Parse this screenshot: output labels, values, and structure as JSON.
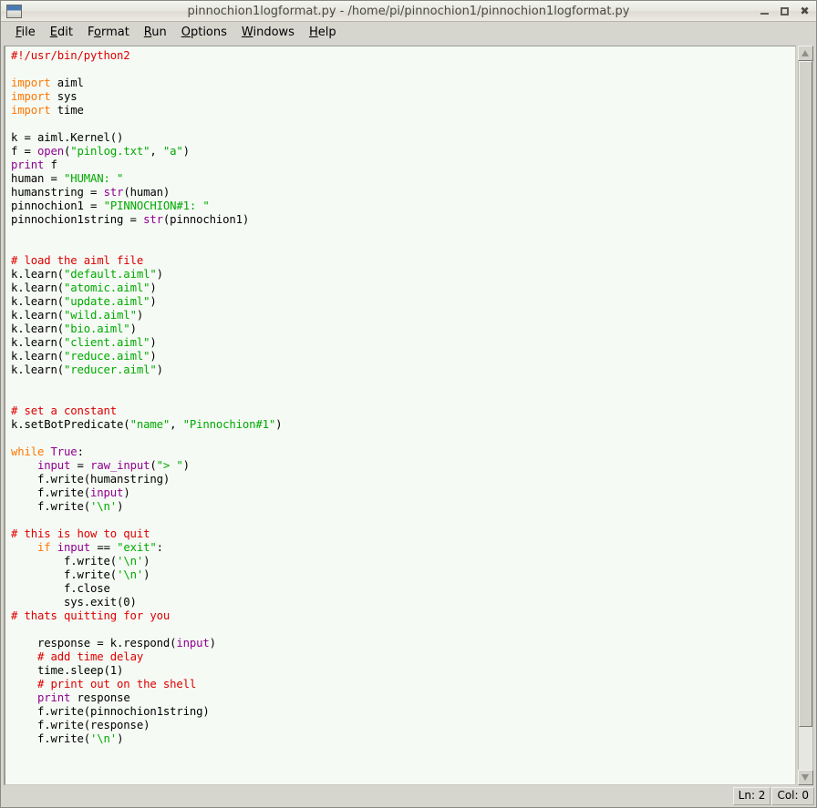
{
  "window": {
    "title": "pinnochion1logformat.py - /home/pi/pinnochion1/pinnochion1logformat.py",
    "icon": "window-icon",
    "minimize_label": "_",
    "maximize_label": "□",
    "close_label": "✖"
  },
  "menubar": {
    "items": [
      {
        "label": "File",
        "mnemonic_index": 0
      },
      {
        "label": "Edit",
        "mnemonic_index": 0
      },
      {
        "label": "Format",
        "mnemonic_index": 1
      },
      {
        "label": "Run",
        "mnemonic_index": 0
      },
      {
        "label": "Options",
        "mnemonic_index": 0
      },
      {
        "label": "Windows",
        "mnemonic_index": 0
      },
      {
        "label": "Help",
        "mnemonic_index": 0
      }
    ]
  },
  "statusbar": {
    "line_label": "Ln: 2",
    "column_label": "Col: 0"
  },
  "colors": {
    "comment": "#dd0000",
    "keyword": "#ff7700",
    "string": "#00aa00",
    "builtin": "#900090",
    "plain": "#000000",
    "editor_background": "#f6faf5",
    "chrome": "#d6d6ce"
  },
  "editor": {
    "filename": "pinnochion1logformat.py",
    "language": "python",
    "lines": [
      [
        {
          "t": "#!/usr/bin/python2",
          "c": "comment"
        }
      ],
      [],
      [
        {
          "t": "import",
          "c": "keyword"
        },
        {
          "t": " aiml",
          "c": "plain"
        }
      ],
      [
        {
          "t": "import",
          "c": "keyword"
        },
        {
          "t": " sys",
          "c": "plain"
        }
      ],
      [
        {
          "t": "import",
          "c": "keyword"
        },
        {
          "t": " time",
          "c": "plain"
        }
      ],
      [],
      [
        {
          "t": "k = aiml.Kernel()",
          "c": "plain"
        }
      ],
      [
        {
          "t": "f = ",
          "c": "plain"
        },
        {
          "t": "open",
          "c": "builtin"
        },
        {
          "t": "(",
          "c": "plain"
        },
        {
          "t": "\"pinlog.txt\"",
          "c": "string"
        },
        {
          "t": ", ",
          "c": "plain"
        },
        {
          "t": "\"a\"",
          "c": "string"
        },
        {
          "t": ")",
          "c": "plain"
        }
      ],
      [
        {
          "t": "print",
          "c": "builtin"
        },
        {
          "t": " f",
          "c": "plain"
        }
      ],
      [
        {
          "t": "human = ",
          "c": "plain"
        },
        {
          "t": "\"HUMAN: \"",
          "c": "string"
        }
      ],
      [
        {
          "t": "humanstring = ",
          "c": "plain"
        },
        {
          "t": "str",
          "c": "builtin"
        },
        {
          "t": "(human)",
          "c": "plain"
        }
      ],
      [
        {
          "t": "pinnochion1 = ",
          "c": "plain"
        },
        {
          "t": "\"PINNOCHION#1: \"",
          "c": "string"
        }
      ],
      [
        {
          "t": "pinnochion1string = ",
          "c": "plain"
        },
        {
          "t": "str",
          "c": "builtin"
        },
        {
          "t": "(pinnochion1)",
          "c": "plain"
        }
      ],
      [],
      [],
      [
        {
          "t": "# load the aiml file",
          "c": "comment"
        }
      ],
      [
        {
          "t": "k.learn(",
          "c": "plain"
        },
        {
          "t": "\"default.aiml\"",
          "c": "string"
        },
        {
          "t": ")",
          "c": "plain"
        }
      ],
      [
        {
          "t": "k.learn(",
          "c": "plain"
        },
        {
          "t": "\"atomic.aiml\"",
          "c": "string"
        },
        {
          "t": ")",
          "c": "plain"
        }
      ],
      [
        {
          "t": "k.learn(",
          "c": "plain"
        },
        {
          "t": "\"update.aiml\"",
          "c": "string"
        },
        {
          "t": ")",
          "c": "plain"
        }
      ],
      [
        {
          "t": "k.learn(",
          "c": "plain"
        },
        {
          "t": "\"wild.aiml\"",
          "c": "string"
        },
        {
          "t": ")",
          "c": "plain"
        }
      ],
      [
        {
          "t": "k.learn(",
          "c": "plain"
        },
        {
          "t": "\"bio.aiml\"",
          "c": "string"
        },
        {
          "t": ")",
          "c": "plain"
        }
      ],
      [
        {
          "t": "k.learn(",
          "c": "plain"
        },
        {
          "t": "\"client.aiml\"",
          "c": "string"
        },
        {
          "t": ")",
          "c": "plain"
        }
      ],
      [
        {
          "t": "k.learn(",
          "c": "plain"
        },
        {
          "t": "\"reduce.aiml\"",
          "c": "string"
        },
        {
          "t": ")",
          "c": "plain"
        }
      ],
      [
        {
          "t": "k.learn(",
          "c": "plain"
        },
        {
          "t": "\"reducer.aiml\"",
          "c": "string"
        },
        {
          "t": ")",
          "c": "plain"
        }
      ],
      [],
      [],
      [
        {
          "t": "# set a constant",
          "c": "comment"
        }
      ],
      [
        {
          "t": "k.setBotPredicate(",
          "c": "plain"
        },
        {
          "t": "\"name\"",
          "c": "string"
        },
        {
          "t": ", ",
          "c": "plain"
        },
        {
          "t": "\"Pinnochion#1\"",
          "c": "string"
        },
        {
          "t": ")",
          "c": "plain"
        }
      ],
      [],
      [
        {
          "t": "while",
          "c": "keyword"
        },
        {
          "t": " ",
          "c": "plain"
        },
        {
          "t": "True",
          "c": "builtin"
        },
        {
          "t": ":",
          "c": "plain"
        }
      ],
      [
        {
          "t": "    ",
          "c": "plain"
        },
        {
          "t": "input",
          "c": "builtin"
        },
        {
          "t": " = ",
          "c": "plain"
        },
        {
          "t": "raw_input",
          "c": "builtin"
        },
        {
          "t": "(",
          "c": "plain"
        },
        {
          "t": "\"> \"",
          "c": "string"
        },
        {
          "t": ")",
          "c": "plain"
        }
      ],
      [
        {
          "t": "    f.write(humanstring)",
          "c": "plain"
        }
      ],
      [
        {
          "t": "    f.write(",
          "c": "plain"
        },
        {
          "t": "input",
          "c": "builtin"
        },
        {
          "t": ")",
          "c": "plain"
        }
      ],
      [
        {
          "t": "    f.write(",
          "c": "plain"
        },
        {
          "t": "'\\n'",
          "c": "string"
        },
        {
          "t": ")",
          "c": "plain"
        }
      ],
      [],
      [
        {
          "t": "# this is how to quit",
          "c": "comment"
        }
      ],
      [
        {
          "t": "    ",
          "c": "plain"
        },
        {
          "t": "if",
          "c": "keyword"
        },
        {
          "t": " ",
          "c": "plain"
        },
        {
          "t": "input",
          "c": "builtin"
        },
        {
          "t": " == ",
          "c": "plain"
        },
        {
          "t": "\"exit\"",
          "c": "string"
        },
        {
          "t": ":",
          "c": "plain"
        }
      ],
      [
        {
          "t": "        f.write(",
          "c": "plain"
        },
        {
          "t": "'\\n'",
          "c": "string"
        },
        {
          "t": ")",
          "c": "plain"
        }
      ],
      [
        {
          "t": "        f.write(",
          "c": "plain"
        },
        {
          "t": "'\\n'",
          "c": "string"
        },
        {
          "t": ")",
          "c": "plain"
        }
      ],
      [
        {
          "t": "        f.close",
          "c": "plain"
        }
      ],
      [
        {
          "t": "        sys.exit(0)",
          "c": "plain"
        }
      ],
      [
        {
          "t": "# thats quitting for you",
          "c": "comment"
        }
      ],
      [],
      [
        {
          "t": "    response = k.respond(",
          "c": "plain"
        },
        {
          "t": "input",
          "c": "builtin"
        },
        {
          "t": ")",
          "c": "plain"
        }
      ],
      [
        {
          "t": "    ",
          "c": "plain"
        },
        {
          "t": "# add time delay",
          "c": "comment"
        }
      ],
      [
        {
          "t": "    time.sleep(1)",
          "c": "plain"
        }
      ],
      [
        {
          "t": "    ",
          "c": "plain"
        },
        {
          "t": "# print out on the shell",
          "c": "comment"
        }
      ],
      [
        {
          "t": "    ",
          "c": "plain"
        },
        {
          "t": "print",
          "c": "builtin"
        },
        {
          "t": " response",
          "c": "plain"
        }
      ],
      [
        {
          "t": "    f.write(pinnochion1string)",
          "c": "plain"
        }
      ],
      [
        {
          "t": "    f.write(response)",
          "c": "plain"
        }
      ],
      [
        {
          "t": "    f.write(",
          "c": "plain"
        },
        {
          "t": "'\\n'",
          "c": "string"
        },
        {
          "t": ")",
          "c": "plain"
        }
      ]
    ]
  }
}
